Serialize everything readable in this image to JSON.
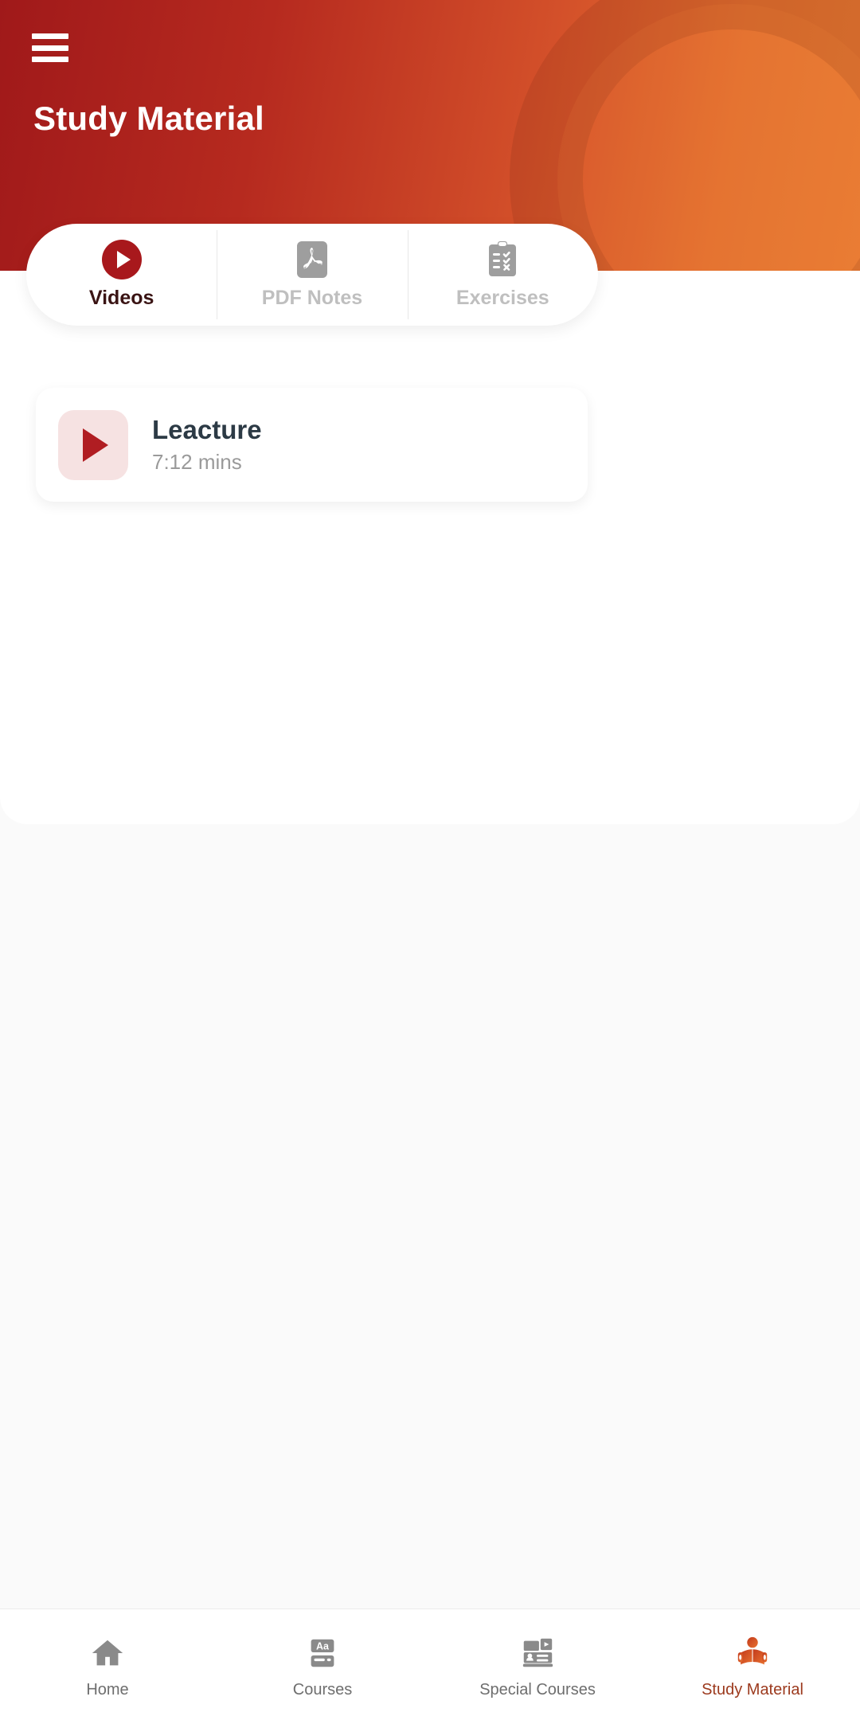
{
  "header": {
    "title": "Study Material",
    "menu_icon": "hamburger-menu-icon",
    "gradient_start": "#A0191A",
    "gradient_end": "#E87B33"
  },
  "tabs": [
    {
      "label": "Videos",
      "icon": "play-circle-icon",
      "active": true
    },
    {
      "label": "PDF Notes",
      "icon": "pdf-file-icon",
      "active": false
    },
    {
      "label": "Exercises",
      "icon": "clipboard-check-icon",
      "active": false
    }
  ],
  "content": {
    "items": [
      {
        "title": "Leacture",
        "duration": "7:12 mins",
        "icon": "play-triangle-icon"
      }
    ]
  },
  "bottom_nav": {
    "items": [
      {
        "label": "Home",
        "icon": "home-icon",
        "active": false
      },
      {
        "label": "Courses",
        "icon": "book-aa-icon",
        "active": false
      },
      {
        "label": "Special Courses",
        "icon": "presentation-icon",
        "active": false
      },
      {
        "label": "Study Material",
        "icon": "person-reading-icon",
        "active": true
      }
    ],
    "active_color": "#9C3A1E",
    "inactive_color": "#8A8A8A"
  },
  "colors": {
    "accent_red": "#A8181C",
    "accent_orange": "#E8712F",
    "title_text": "#2C3A45",
    "muted_text": "#9A9A9A",
    "tab_inactive": "#BFBFBF",
    "page_background": "#FAFAFA"
  }
}
